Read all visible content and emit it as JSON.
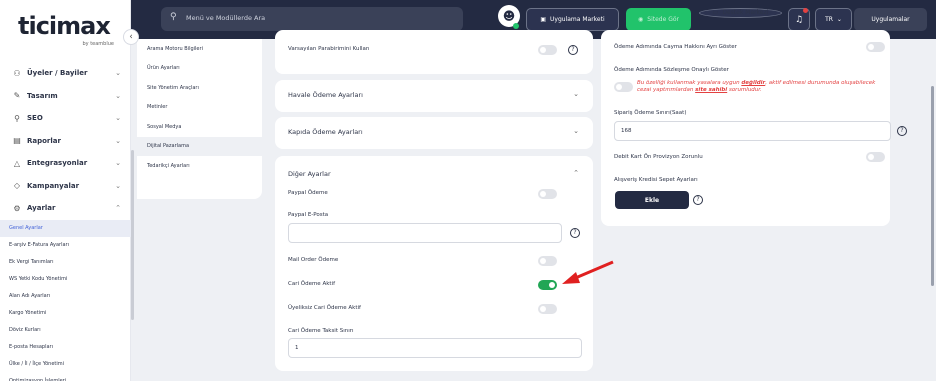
{
  "logo": {
    "name": "ticimax",
    "sub": "by teamblue"
  },
  "topbar": {
    "search_placeholder": "Menü ve Modüllerde Ara",
    "market_label": "Uygulama Marketi",
    "site_label": "Sitede Gör",
    "help_label": "Destek Merkezi",
    "lang_label": "TR",
    "apps_label": "Uygulamalar"
  },
  "sidebar": {
    "items": [
      {
        "label": "Üyeler / Bayiler",
        "icon": "users-icon"
      },
      {
        "label": "Tasarım",
        "icon": "brush-icon"
      },
      {
        "label": "SEO",
        "icon": "search-icon"
      },
      {
        "label": "Raporlar",
        "icon": "report-icon"
      },
      {
        "label": "Entegrasyonlar",
        "icon": "integration-icon"
      },
      {
        "label": "Kampanyalar",
        "icon": "tag-icon"
      },
      {
        "label": "Ayarlar",
        "icon": "gear-icon"
      }
    ],
    "sub_items": [
      "Genel Ayarlar",
      "E-arşiv E-Fatura Ayarları",
      "Ek Vergi Tanımları",
      "WS Yetki Kodu Yönetimi",
      "Alan Adı Ayarları",
      "Kargo Yönetimi",
      "Döviz Kurları",
      "E-posta Hesapları",
      "Ülke / İl / İlçe Yönetimi",
      "Optimizasyon İşlemleri"
    ]
  },
  "submenu": [
    "Arama Motoru Bilgileri",
    "Ürün Ayarları",
    "Site Yönetim Araçları",
    "Metinler",
    "Sosyal Medya",
    "Dijital Pazarlama",
    "Tedarikçi Ayarları"
  ],
  "middle": {
    "default_currency": "Varsayılan Parabirimini Kullan",
    "havale": "Havale Ödeme Ayarları",
    "kapida": "Kapıda Ödeme Ayarları",
    "diger": "Diğer Ayarlar",
    "paypal": "Paypal Ödeme",
    "paypal_email": "Paypal E-Posta",
    "mail_order": "Mail Order Ödeme",
    "cari_odeme": "Cari Ödeme Aktif",
    "uyeliksiz_cari": "Üyeliksiz Cari Ödeme Aktif",
    "taksit_label": "Cari Ödeme Taksit Sınırı",
    "taksit_value": "1"
  },
  "right": {
    "cayma": "Ödeme Adımında Cayma Hakkını Ayrı Göster",
    "sozlesme": "Ödeme Adımında Sözleşme Onaylı Göster",
    "warn_part1": "Bu özelliği kullanmak yasalara uygun ",
    "warn_bold1": "değildir",
    "warn_part2": ", aktif edilmesi durumunda oluşabilecek cezai yaptırımlardan ",
    "warn_bold2": "site sahibi",
    "warn_part3": " sorumludur.",
    "siparis_label": "Sipariş Ödeme Sınırı(Saat)",
    "siparis_value": "168",
    "debit": "Debit Kart Ön Provizyon Zorunlu",
    "alisveris": "Alışveriş Kredisi Sepet Ayarları",
    "ekle": "Ekle"
  },
  "toggles": {
    "cari_odeme": true,
    "default_currency": false,
    "paypal": false,
    "mail_order": false,
    "uyeliksiz_cari": false,
    "cayma": false,
    "sozlesme": false,
    "debit": false
  },
  "colors": {
    "accent_green": "#21a655",
    "topbar": "#232a42",
    "warn_red": "#e34141",
    "arrow_red": "#e02020"
  }
}
